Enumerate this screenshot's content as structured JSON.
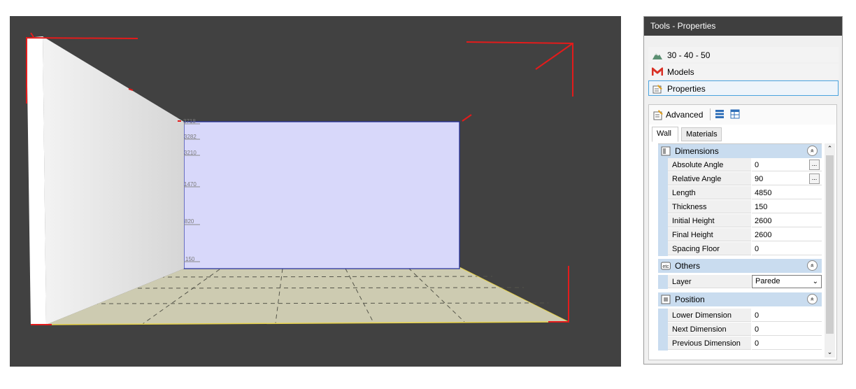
{
  "viewport": {
    "dimension_labels": [
      "3718",
      "3282",
      "3210",
      "1470",
      "820",
      "150"
    ]
  },
  "panel": {
    "title": "Tools - Properties",
    "nav": [
      {
        "label": "30 - 40 - 50",
        "icon": "mountain-icon"
      },
      {
        "label": "Models",
        "icon": "models-icon"
      },
      {
        "label": "Properties",
        "icon": "properties-icon"
      }
    ],
    "toolbar": {
      "advanced_label": "Advanced"
    },
    "tabs": [
      {
        "label": "Wall"
      },
      {
        "label": "Materials"
      }
    ],
    "categories": {
      "dimensions": {
        "label": "Dimensions",
        "rows": [
          {
            "name": "Absolute Angle",
            "value": "0"
          },
          {
            "name": "Relative Angle",
            "value": "90"
          },
          {
            "name": "Length",
            "value": "4850"
          },
          {
            "name": "Thickness",
            "value": "150"
          },
          {
            "name": "Initial Height",
            "value": "2600"
          },
          {
            "name": "Final Height",
            "value": "2600"
          },
          {
            "name": "Spacing Floor",
            "value": "0"
          }
        ]
      },
      "others": {
        "label": "Others",
        "rows": [
          {
            "name": "Layer",
            "value": "Parede"
          }
        ]
      },
      "position": {
        "label": "Position",
        "rows": [
          {
            "name": "Lower Dimension",
            "value": "0"
          },
          {
            "name": "Next Dimension",
            "value": "0"
          },
          {
            "name": "Previous Dimension",
            "value": "0"
          }
        ]
      }
    },
    "ellipsis": "...",
    "collapse_glyph": "«"
  }
}
